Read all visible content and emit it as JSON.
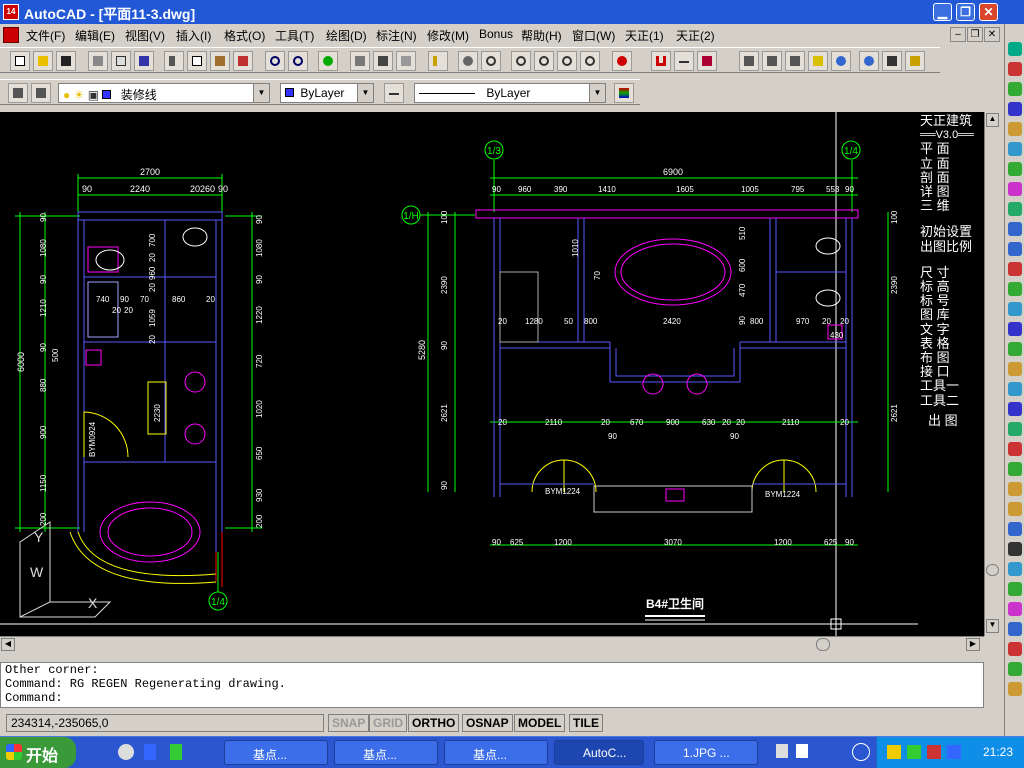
{
  "window": {
    "title": "AutoCAD - [平面11-3.dwg]",
    "app_icon": "autocad-icon",
    "minimize_glyph": "▁",
    "restore_glyph": "❐",
    "close_glyph": "✕"
  },
  "menu": [
    "文件(F)",
    "编辑(E)",
    "视图(V)",
    "插入(I)",
    "格式(O)",
    "工具(T)",
    "绘图(D)",
    "标注(N)",
    "修改(M)",
    "Bonus",
    "帮助(H)",
    "窗口(W)",
    "天正(1)",
    "天正(2)"
  ],
  "mdi_controls": {
    "min": "–",
    "restore": "❐",
    "close": "✕"
  },
  "layer_toolbar": {
    "current_layer": "装修线",
    "color": "ByLayer",
    "linetype": "ByLayer"
  },
  "tianzheng": {
    "header": "天正建筑",
    "version": "══V3.0══",
    "items": [
      "平 面",
      "立 面",
      "剖 面",
      "详 图",
      "三 维"
    ],
    "setup": [
      "初始设置",
      "出图比例"
    ],
    "items2": [
      "尺 寸",
      "标 高",
      "标 号",
      "图 库",
      "文 字",
      "表 格",
      "布 图",
      "接 口",
      "工具一",
      "工具二"
    ],
    "output": "出 图"
  },
  "drawing": {
    "left_plan": {
      "overall_width": "2700",
      "top_dims": [
        "90",
        "2240",
        "20",
        "260",
        "90"
      ],
      "left_overall": "6000",
      "left_dims": [
        "90",
        "1080",
        "90",
        "1210",
        "90",
        "500",
        "880",
        "900",
        "1150",
        "200"
      ],
      "right_dims": [
        "90",
        "1080",
        "90",
        "1220",
        "720",
        "1020",
        "650",
        "930",
        "200"
      ],
      "inner_dims": [
        "700",
        "20",
        "960",
        "20",
        "740",
        "90",
        "20",
        "20",
        "70",
        "860",
        "20",
        "1059",
        "20",
        "2230"
      ],
      "door_label": "BYM0924",
      "axis_label": "1/4"
    },
    "right_plan": {
      "overall_width": "6900",
      "top_dims": [
        "90",
        "960",
        "390",
        "1410",
        "1605",
        "1005",
        "795",
        "553",
        "90"
      ],
      "left_overall": "5280",
      "left_dims": [
        "100",
        "2390",
        "90",
        "2621",
        "90"
      ],
      "right_dims": [
        "100",
        "2390",
        "2621"
      ],
      "inner_dims": [
        "1010",
        "70",
        "20",
        "1280",
        "50",
        "800",
        "2420",
        "510",
        "600",
        "470",
        "90",
        "800",
        "970",
        "20",
        "20",
        "430"
      ],
      "mid_dims": [
        "20",
        "2110",
        "20",
        "90",
        "670",
        "900",
        "630",
        "20",
        "20",
        "90",
        "2110",
        "20"
      ],
      "bottom_dims": [
        "90",
        "625",
        "1200",
        "3070",
        "1200",
        "625",
        "90"
      ],
      "door_labels": [
        "BYM1224",
        "BYM1224"
      ],
      "axis_labels": [
        "1/3",
        "1/4",
        "1/H"
      ],
      "room_title": "B4#卫生间"
    },
    "ucs_labels": [
      "Y",
      "W",
      "X"
    ]
  },
  "command": {
    "lines": [
      "Other corner:",
      "Command: RG REGEN Regenerating drawing.",
      "Command:"
    ]
  },
  "status": {
    "coords": "234314,-235065,0",
    "toggles": [
      {
        "label": "SNAP",
        "on": false
      },
      {
        "label": "GRID",
        "on": false
      },
      {
        "label": "ORTHO",
        "on": true
      },
      {
        "label": "OSNAP",
        "on": true
      },
      {
        "label": "MODEL",
        "on": true
      },
      {
        "label": "TILE",
        "on": true
      }
    ]
  },
  "taskbar": {
    "start": "开始",
    "tasks": [
      "基点...",
      "基点...",
      "基点...",
      "AutoC...",
      "1.JPG ..."
    ],
    "clock": "21:23"
  },
  "colors": {
    "titlebar": "#2258d6",
    "taskbar": "#2a57cf",
    "canvas": "#000000",
    "dim_green": "#00ff00",
    "wall_blue": "#5a5aff",
    "fixture_magenta": "#ff00ff",
    "annotation_yellow": "#ffff00",
    "axis_red": "#ff0000"
  }
}
